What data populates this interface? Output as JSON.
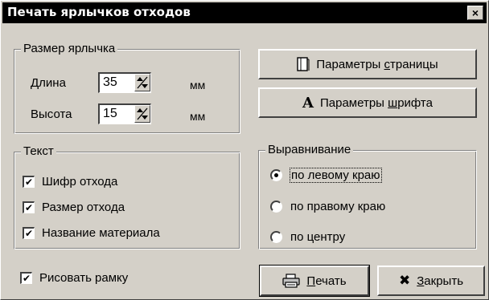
{
  "window": {
    "title": "Печать ярлычков отходов",
    "close_glyph": "×"
  },
  "size_group": {
    "legend": "Размер ярлычка",
    "length_label": "Длина",
    "length_value": "35",
    "length_unit": "мм",
    "height_label": "Высота",
    "height_value": "15",
    "height_unit": "мм"
  },
  "buttons": {
    "page_params_prefix": "Параметры ",
    "page_params_accel": "с",
    "page_params_suffix": "траницы",
    "font_params_prefix": "Параметры ",
    "font_params_accel": "ш",
    "font_params_suffix": "рифта",
    "font_icon_glyph": "A",
    "print_accel": "П",
    "print_suffix": "ечать",
    "close_accel": "З",
    "close_suffix": "акрыть",
    "close_icon_glyph": "✖"
  },
  "text_group": {
    "legend": "Текст",
    "items": [
      {
        "label": "Шифр отхода",
        "checked": true,
        "mark": "✔"
      },
      {
        "label": "Размер отхода",
        "checked": true,
        "mark": "✔"
      },
      {
        "label": "Название материала",
        "checked": true,
        "mark": "✔"
      }
    ]
  },
  "align_group": {
    "legend": "Выравнивание",
    "options": [
      {
        "label": "по левому краю",
        "selected": true
      },
      {
        "label": "по правому краю",
        "selected": false
      },
      {
        "label": "по центру",
        "selected": false
      }
    ]
  },
  "draw_frame": {
    "label": "Рисовать рамку",
    "checked": true,
    "mark": "✔"
  }
}
